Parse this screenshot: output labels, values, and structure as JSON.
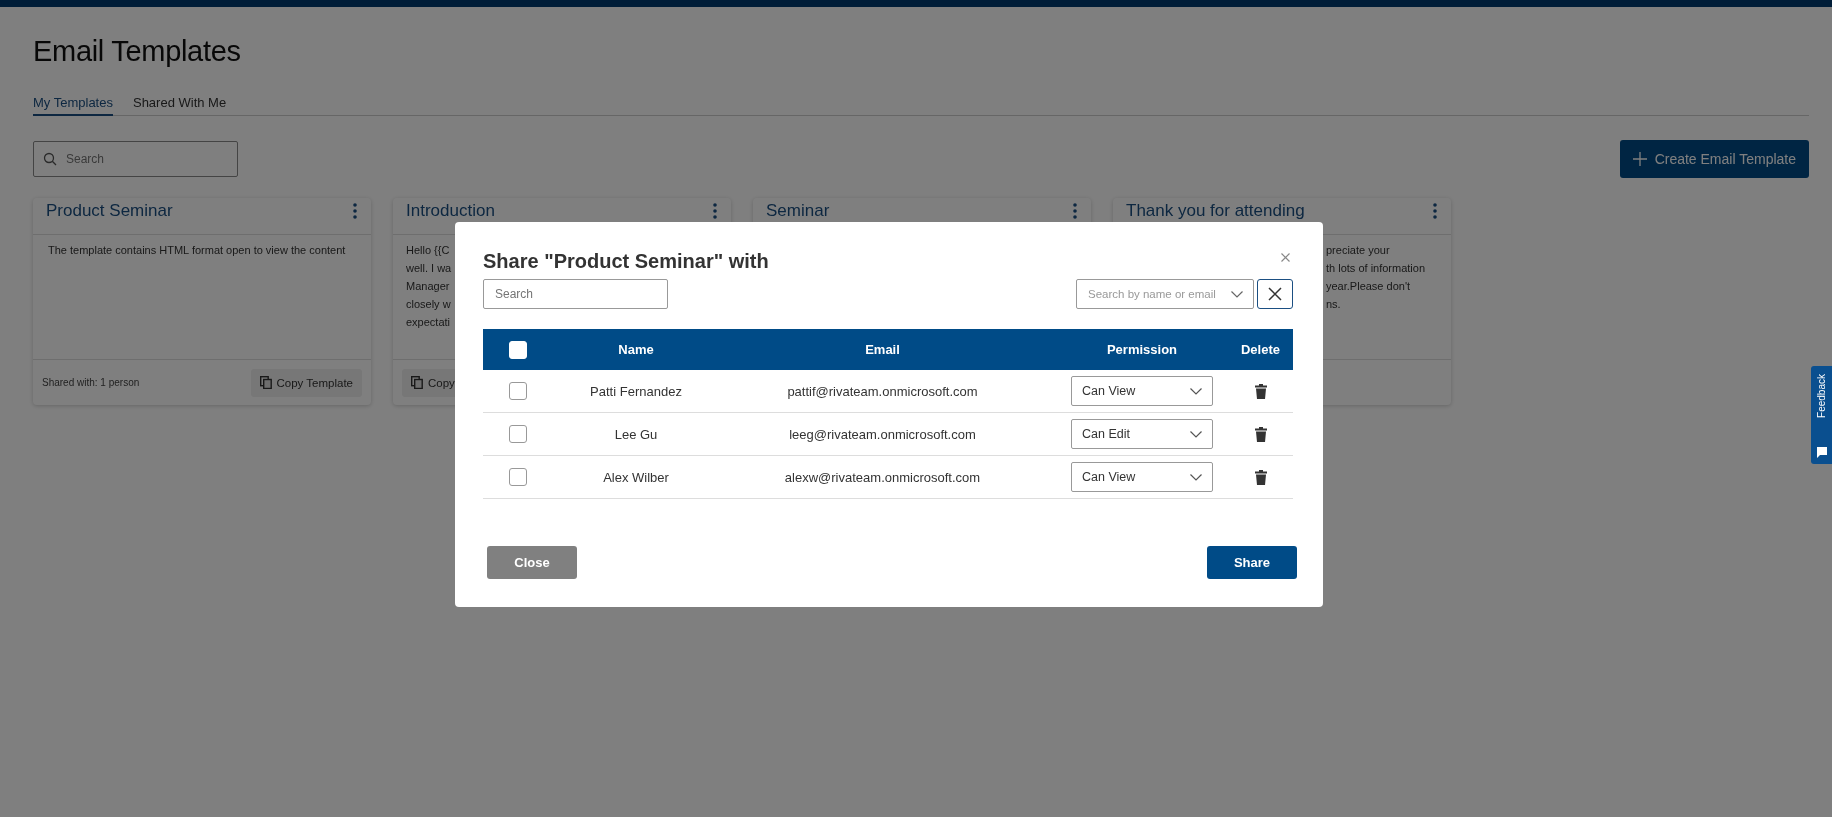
{
  "page": {
    "title": "Email Templates"
  },
  "tabs": [
    {
      "label": "My Templates",
      "selected": true
    },
    {
      "label": "Shared With Me",
      "selected": false
    }
  ],
  "search": {
    "placeholder": "Search"
  },
  "create_button": {
    "label": "Create Email Template"
  },
  "cards": [
    {
      "title": "Product Seminar",
      "body_lines": [
        "The template contains HTML format open to view the content"
      ],
      "shared_with": "Shared with: 1 person",
      "copy_label": "Copy Template",
      "kind": "full"
    },
    {
      "title": "Introduction",
      "body_lines": [
        "Hello {{C",
        "well. I wa",
        "Manager",
        "closely w",
        "expectati"
      ],
      "copy_label": "Copy",
      "kind": "left"
    },
    {
      "title": "Seminar",
      "kind": "left"
    },
    {
      "title": "Thank you for attending",
      "body_lines": [
        "preciate your",
        "th lots of information",
        "year.Please don't",
        "ns."
      ],
      "kind": "right"
    }
  ],
  "feedback_tab": {
    "label": "Feedback"
  },
  "dialog": {
    "title": "Share \"Product Seminar\" with",
    "search": {
      "placeholder": "Search"
    },
    "people_picker": {
      "placeholder": "Search by name or email"
    },
    "select_all": {
      "checked": false
    },
    "columns": [
      "Name",
      "Email",
      "Permission",
      "Delete"
    ],
    "rows": [
      {
        "checked": false,
        "name": "Patti Fernandez",
        "email": "pattif@rivateam.onmicrosoft.com",
        "permission": "Can View"
      },
      {
        "checked": false,
        "name": "Lee Gu",
        "email": "leeg@rivateam.onmicrosoft.com",
        "permission": "Can Edit"
      },
      {
        "checked": false,
        "name": "Alex Wilber",
        "email": "alexw@rivateam.onmicrosoft.com",
        "permission": "Can View"
      }
    ],
    "buttons": [
      {
        "label": "Close",
        "kind": "secondary"
      },
      {
        "label": "Share",
        "kind": "primary"
      }
    ]
  }
}
